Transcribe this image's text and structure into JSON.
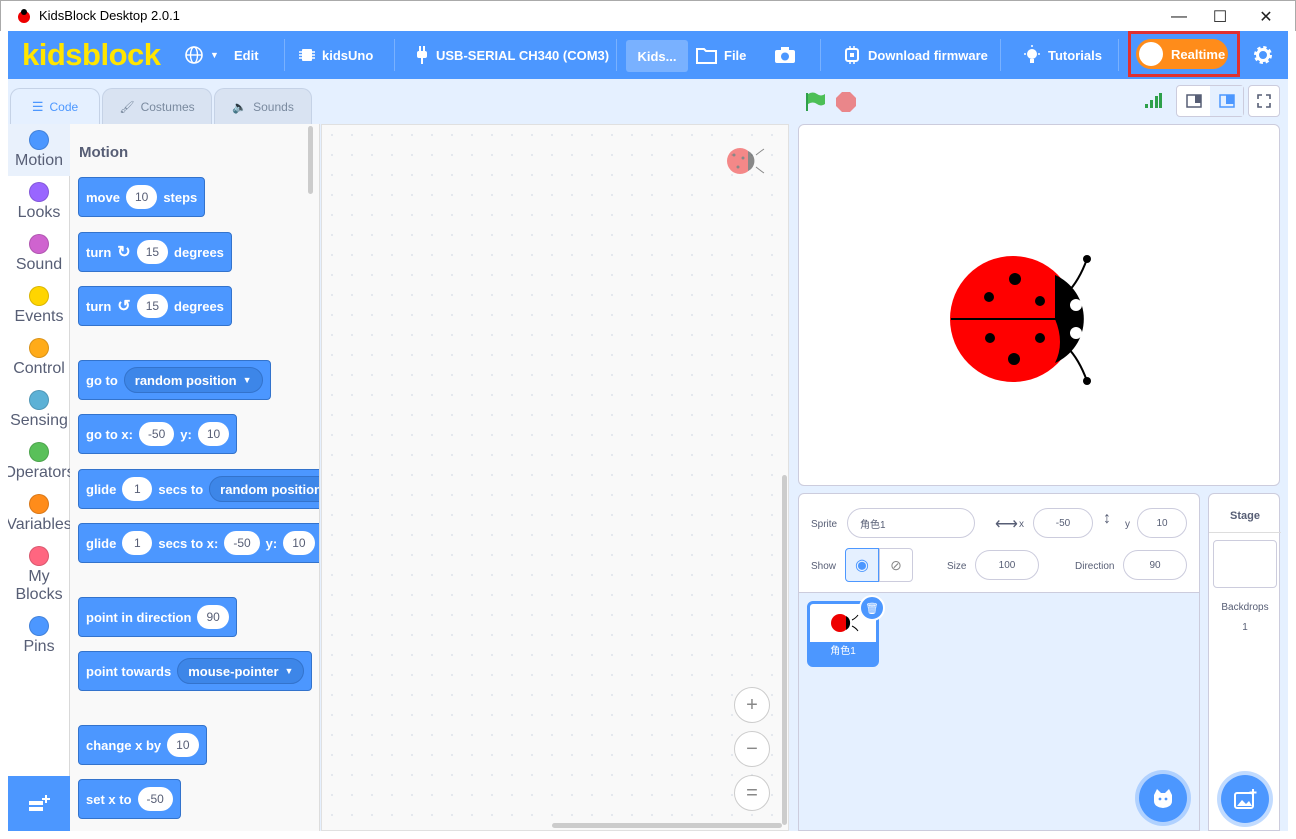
{
  "window": {
    "title": "KidsBlock Desktop 2.0.1",
    "minimize": "—",
    "maximize": "☐",
    "close": "✕"
  },
  "menubar": {
    "logo": "kidsblock",
    "edit": "Edit",
    "board": "kidsUno",
    "port": "USB-SERIAL CH340 (COM3)",
    "project": "Kids...",
    "file": "File",
    "download": "Download firmware",
    "tutorials": "Tutorials",
    "realtime": "Realtime"
  },
  "tabs": {
    "code": "Code",
    "costumes": "Costumes",
    "sounds": "Sounds"
  },
  "categories": [
    {
      "label": "Motion",
      "color": "#4c97ff"
    },
    {
      "label": "Looks",
      "color": "#9966ff"
    },
    {
      "label": "Sound",
      "color": "#cf63cf"
    },
    {
      "label": "Events",
      "color": "#ffd500"
    },
    {
      "label": "Control",
      "color": "#ffab19"
    },
    {
      "label": "Sensing",
      "color": "#5cb1d6"
    },
    {
      "label": "Operators",
      "color": "#59c059"
    },
    {
      "label": "Variables",
      "color": "#ff8c1a"
    },
    {
      "label": "My Blocks",
      "color": "#ff6680"
    },
    {
      "label": "Pins",
      "color": "#4c97ff"
    }
  ],
  "palette": {
    "heading": "Motion",
    "move": {
      "a": "move",
      "v": "10",
      "b": "steps"
    },
    "turn_right": {
      "a": "turn",
      "v": "15",
      "b": "degrees"
    },
    "turn_left": {
      "a": "turn",
      "v": "15",
      "b": "degrees"
    },
    "goto": {
      "a": "go to",
      "opt": "random position"
    },
    "goto_xy": {
      "a": "go to x:",
      "x": "-50",
      "b": "y:",
      "y": "10"
    },
    "glide": {
      "a": "glide",
      "v": "1",
      "b": "secs to",
      "opt": "random position"
    },
    "glide_xy": {
      "a": "glide",
      "v": "1",
      "b": "secs to x:",
      "x": "-50",
      "c": "y:",
      "y": "10"
    },
    "point_dir": {
      "a": "point in direction",
      "v": "90"
    },
    "point_towards": {
      "a": "point towards",
      "opt": "mouse-pointer"
    },
    "change_x": {
      "a": "change x by",
      "v": "10"
    },
    "set_x": {
      "a": "set x to",
      "v": "-50"
    }
  },
  "zoom": {
    "in": "+",
    "out": "−",
    "reset": "="
  },
  "sprite_info": {
    "sprite_label": "Sprite",
    "sprite_name": "角色1",
    "x_label": "x",
    "x": "-50",
    "y_label": "y",
    "y": "10",
    "show_label": "Show",
    "size_label": "Size",
    "size": "100",
    "direction_label": "Direction",
    "direction": "90"
  },
  "sprites": [
    {
      "name": "角色1"
    }
  ],
  "stage_panel": {
    "title": "Stage",
    "backdrops_label": "Backdrops",
    "backdrops_count": "1"
  },
  "colors": {
    "accent": "#4c97ff",
    "realtime": "#ff8c1a",
    "highlight": "#e03030"
  }
}
